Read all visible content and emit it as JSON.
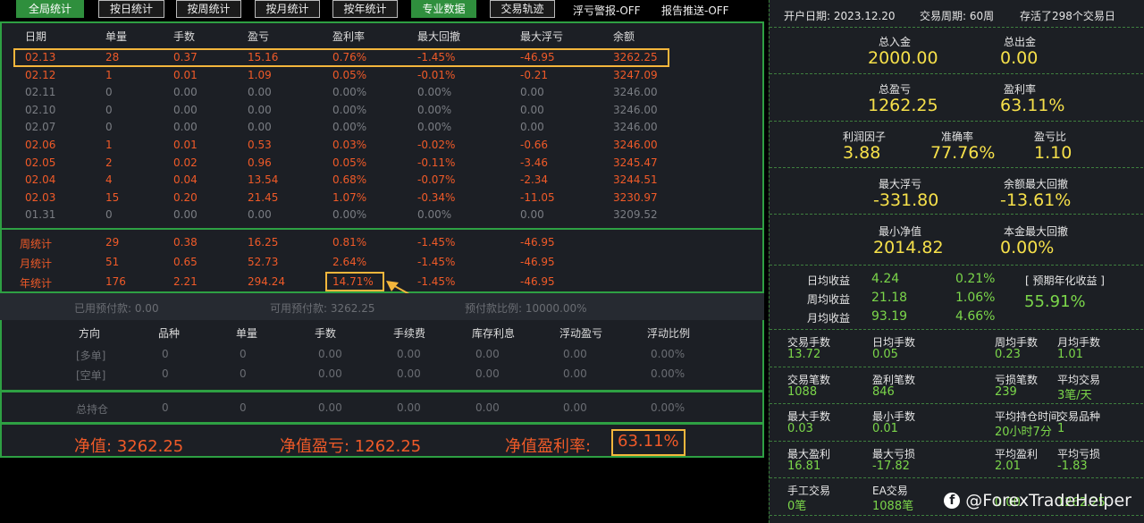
{
  "tabs": [
    "全局统计",
    "按日统计",
    "按周统计",
    "按月统计",
    "按年统计",
    "专业数据",
    "交易轨迹"
  ],
  "toggles": [
    "浮亏警报-OFF",
    "报告推送-OFF"
  ],
  "daily": {
    "headers": [
      "日期",
      "单量",
      "手数",
      "盈亏",
      "盈利率",
      "最大回撤",
      "最大浮亏",
      "余额"
    ],
    "rows": [
      [
        "02.13",
        "28",
        "0.37",
        "15.16",
        "0.76%",
        "-1.45%",
        "-46.95",
        "3262.25"
      ],
      [
        "02.12",
        "1",
        "0.01",
        "1.09",
        "0.05%",
        "-0.01%",
        "-0.21",
        "3247.09"
      ],
      [
        "02.11",
        "0",
        "0.00",
        "0.00",
        "0.00%",
        "0.00%",
        "0.00",
        "3246.00"
      ],
      [
        "02.10",
        "0",
        "0.00",
        "0.00",
        "0.00%",
        "0.00%",
        "0.00",
        "3246.00"
      ],
      [
        "02.07",
        "0",
        "0.00",
        "0.00",
        "0.00%",
        "0.00%",
        "0.00",
        "3246.00"
      ],
      [
        "02.06",
        "1",
        "0.01",
        "0.53",
        "0.03%",
        "-0.02%",
        "-0.66",
        "3246.00"
      ],
      [
        "02.05",
        "2",
        "0.02",
        "0.96",
        "0.05%",
        "-0.11%",
        "-3.46",
        "3245.47"
      ],
      [
        "02.04",
        "4",
        "0.04",
        "13.54",
        "0.68%",
        "-0.07%",
        "-2.34",
        "3244.51"
      ],
      [
        "02.03",
        "15",
        "0.20",
        "21.45",
        "1.07%",
        "-0.34%",
        "-11.05",
        "3230.97"
      ],
      [
        "01.31",
        "0",
        "0.00",
        "0.00",
        "0.00%",
        "0.00%",
        "0.00",
        "3209.52"
      ]
    ],
    "row_active": [
      true,
      true,
      false,
      false,
      false,
      true,
      true,
      true,
      true,
      false
    ]
  },
  "summary": [
    [
      "周统计",
      "29",
      "0.38",
      "16.25",
      "0.81%",
      "-1.45%",
      "-46.95"
    ],
    [
      "月统计",
      "51",
      "0.65",
      "52.73",
      "2.64%",
      "-1.45%",
      "-46.95"
    ],
    [
      "年统计",
      "176",
      "2.21",
      "294.24",
      "14.71%",
      "-1.45%",
      "-46.95"
    ]
  ],
  "prepay": {
    "used": "已用预付款: 0.00",
    "available": "可用预付款: 3262.25",
    "ratio": "预付款比例: 10000.00%"
  },
  "positions": {
    "headers": [
      "方向",
      "品种",
      "单量",
      "手数",
      "手续费",
      "库存利息",
      "浮动盈亏",
      "浮动比例"
    ],
    "rows": [
      [
        "[多单]",
        "0",
        "0",
        "0.00",
        "0.00",
        "0.00",
        "0.00",
        "0.00%"
      ],
      [
        "[空单]",
        "0",
        "0",
        "0.00",
        "0.00",
        "0.00",
        "0.00",
        "0.00%"
      ]
    ],
    "total": [
      "总持仓",
      "0",
      "0",
      "0.00",
      "0.00",
      "0.00",
      "0.00",
      "0.00%"
    ]
  },
  "net": {
    "equity": "净值: 3262.25",
    "profit": "净值盈亏: 1262.25",
    "rate_label": "净值盈利率:",
    "rate_value": "63.11%"
  },
  "right": {
    "info": [
      "开户日期: 2023.12.20",
      "交易周期: 60周",
      "存活了298个交易日"
    ],
    "deposit_label": "总入金",
    "deposit": "2000.00",
    "withdraw_label": "总出金",
    "withdraw": "0.00",
    "pnl_label": "总盈亏",
    "pnl": "1262.25",
    "rate_label": "盈利率",
    "rate": "63.11%",
    "pf_label": "利润因子",
    "pf": "3.88",
    "acc_label": "准确率",
    "acc": "77.76%",
    "plr_label": "盈亏比",
    "plr": "1.10",
    "maxfl_label": "最大浮亏",
    "maxfl": "-331.80",
    "maxdd_label": "余额最大回撤",
    "maxdd": "-13.61%",
    "minnet_label": "最小净值",
    "minnet": "2014.82",
    "capdd_label": "本金最大回撤",
    "capdd": "0.00%",
    "avg": [
      [
        "日均收益",
        "4.24",
        "0.21%"
      ],
      [
        "周均收益",
        "21.18",
        "1.06%"
      ],
      [
        "月均收益",
        "93.19",
        "4.66%"
      ]
    ],
    "annual_label": "[ 预期年化收益 ]",
    "annual": "55.91%",
    "stats": [
      [
        [
          "交易手数",
          "13.72"
        ],
        [
          "日均手数",
          "0.05"
        ],
        [
          "周均手数",
          "0.23"
        ],
        [
          "月均手数",
          "1.01"
        ]
      ],
      [
        [
          "交易笔数",
          "1088"
        ],
        [
          "盈利笔数",
          "846"
        ],
        [
          "亏损笔数",
          "239"
        ],
        [
          "平均交易",
          "3笔/天"
        ]
      ],
      [
        [
          "最大手数",
          "0.03"
        ],
        [
          "最小手数",
          "0.01"
        ],
        [
          "平均持仓时间",
          "20小时7分"
        ],
        [
          "交易品种",
          "1"
        ]
      ],
      [
        [
          "最大盈利",
          "16.81"
        ],
        [
          "最大亏损",
          "-17.82"
        ],
        [
          "平均盈利",
          "2.01"
        ],
        [
          "平均亏损",
          "-1.83"
        ]
      ],
      [
        [
          "手工交易",
          "0笔"
        ],
        [
          "EA交易",
          "1088笔"
        ],
        [
          "",
          "0.00"
        ],
        [
          "",
          "1262.25"
        ]
      ]
    ],
    "watermark": "@ForexTradeHelper"
  },
  "colors": {
    "accent_green": "#2ea043",
    "loss_red": "#f05a28",
    "value_yellow": "#f6e04a",
    "value_green": "#7bd64a",
    "highlight": "#f4b63c"
  }
}
